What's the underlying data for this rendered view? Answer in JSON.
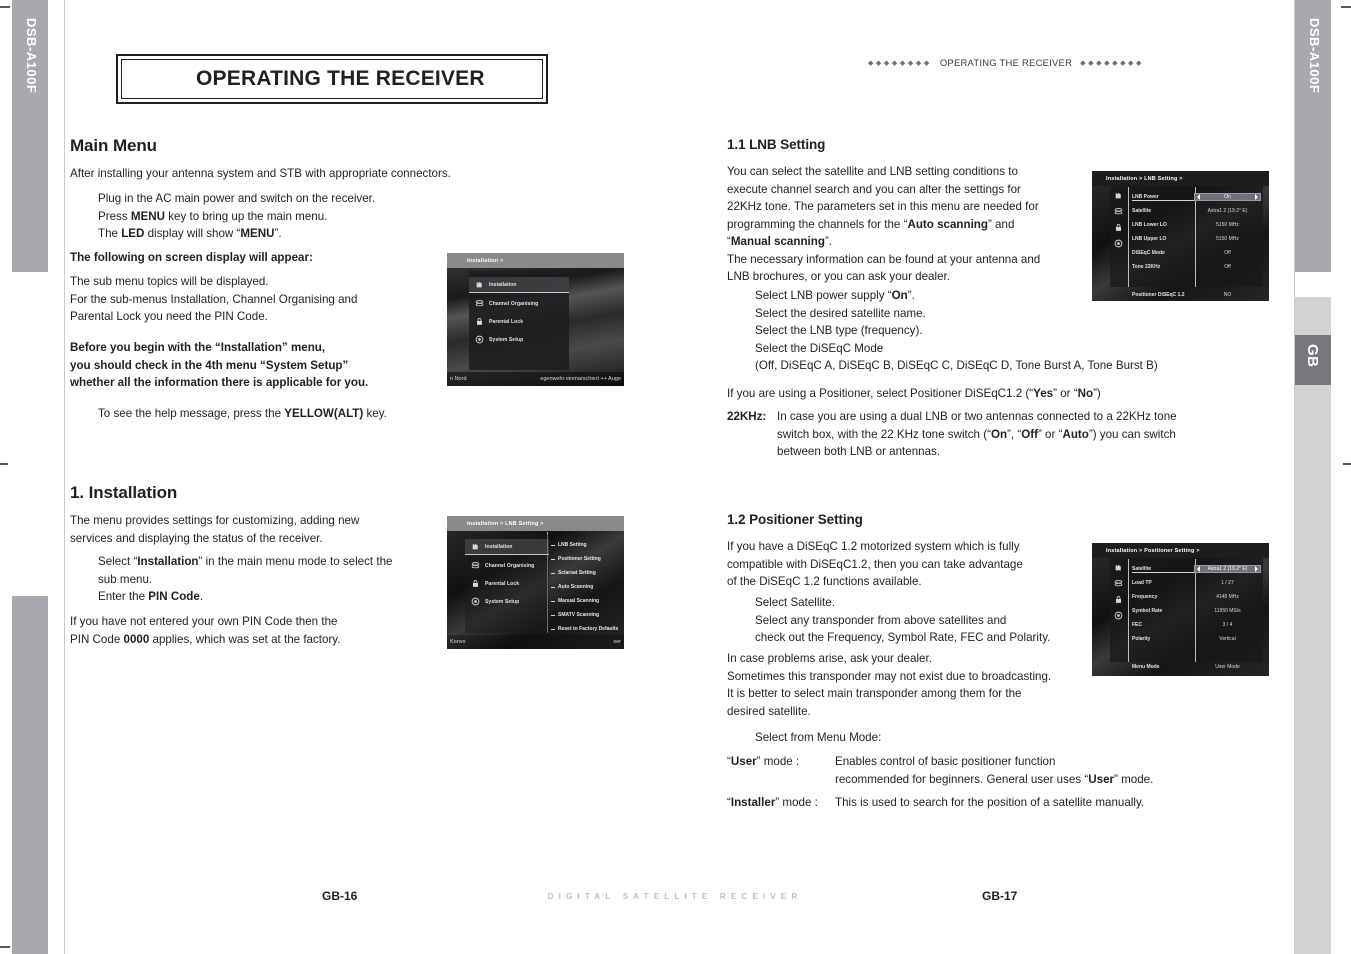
{
  "tabs": {
    "left_top_label": "DSB-A100F",
    "right_top_label": "DSB-A100F",
    "right_lang_label": "GB"
  },
  "left_page": {
    "title": "OPERATING THE RECEIVER",
    "main_menu": {
      "heading": "Main Menu",
      "intro": "After installing your antenna system and STB with appropriate connectors.",
      "steps": [
        "Plug in the AC main power and switch on the receiver.",
        "Press MENU key to bring up the main menu.",
        "The LED display will show “MENU”."
      ],
      "bold_note": "The following on screen display will appear:",
      "para2_line1": "The sub menu topics will be displayed.",
      "para2_line2": "For the sub-menus Installation, Channel Organising and",
      "para2_line3": "Parental Lock you need the PIN Code.",
      "warning_line1": "Before you begin with the “Installation” menu,",
      "warning_line2": "you should check in the 4th menu “System Setup”",
      "warning_line3": "whether all the information there is applicable for you.",
      "help_line": "To see the help message, press the YELLOW(ALT) key."
    },
    "installation": {
      "heading": "1. Installation",
      "intro_line1": "The menu provides settings for customizing, adding new",
      "intro_line2": "services and displaying the status of the receiver.",
      "step1_line1": "Select “Installation” in the main menu mode to select the",
      "step1_line2": "sub menu.",
      "step2": "Enter the PIN Code.",
      "pin_line1": "If you have not entered your own PIN Code then the",
      "pin_line2": "PIN Code 0000 applies, which was set at the factory."
    }
  },
  "right_page": {
    "running_head": "OPERATING THE RECEIVER",
    "lnb": {
      "heading": "1.1 LNB Setting",
      "para_line1": "You can select the satellite and  LNB setting conditions to",
      "para_line2": "execute channel search and you can alter the settings for",
      "para_line3": "22KHz tone. The parameters set in this menu are needed for",
      "para_line4_a": "programming the channels for the “",
      "para_line4_b": "Auto scanning",
      "para_line4_c": "” and",
      "para_line5_a": "“",
      "para_line5_b": "Manual scanning",
      "para_line5_c": "”.",
      "para_line6": "The necessary information can be found at your antenna and",
      "para_line7": "LNB brochures, or you can ask your dealer.",
      "steps": [
        "Select LNB power supply “On”.",
        "Select the desired satellite name.",
        "Select the LNB type (frequency).",
        "Select the DiSEqC Mode",
        "(Off, DiSEqC A, DiSEqC B, DiSEqC C, DiSEqC D, Tone Burst A, Tone Burst B)"
      ],
      "positioner_line": "If you are using a Positioner, select Positioner DiSEqC1.2 (“Yes” or “No”)",
      "khz_label": "22KHz:",
      "khz_line1": "In case you are using a dual LNB or two antennas connected to a 22KHz tone",
      "khz_line2": "switch box, with the 22 KHz tone switch (“On”, “Off” or “Auto”) you can switch",
      "khz_line3": "between both LNB or antennas."
    },
    "positioner": {
      "heading": "1.2 Positioner Setting",
      "para_line1": "If you have a DiSEqC 1.2 motorized system which is fully",
      "para_line2": "compatible with DiSEqC1.2, then you can take advantage",
      "para_line3": "of the DiSEqC 1.2 functions available.",
      "steps": [
        "Select Satellite.",
        "Select any transponder from above satellites and",
        "check out the Frequency, Symbol Rate, FEC and Polarity."
      ],
      "note_line1": "In case problems arise, ask your dealer.",
      "note_line2": "Sometimes this transponder may not exist due to broadcasting.",
      "note_line3": "It is better to select main transponder among them for the",
      "note_line4": "desired satellite.",
      "menu_mode_step": "Select from Menu Mode:",
      "user_mode_label": "“User” mode :",
      "user_mode_line1": "Enables control of basic positioner function",
      "user_mode_line2": "recommended for beginners. General user uses “User” mode.",
      "installer_mode_label": "“Installer” mode :",
      "installer_mode_text": "This is used to search for the position of a satellite manually."
    }
  },
  "osd": {
    "main_menu": {
      "breadcrumb": "Installation >",
      "items": [
        {
          "label": "Installation",
          "icon": "installation-icon",
          "selected": true
        },
        {
          "label": "Channel Organising",
          "icon": "channel-icon",
          "selected": false
        },
        {
          "label": "Parental Lock",
          "icon": "lock-icon",
          "selected": false
        },
        {
          "label": "System Setup",
          "icon": "gear-icon",
          "selected": false
        }
      ],
      "ticker_left": "n Nord",
      "ticker_right": "egenwehr einmarschiert ++ Auge"
    },
    "installation_menu": {
      "breadcrumb": "Installation > LNB Setting >",
      "items": [
        {
          "label": "Installation",
          "icon": "installation-icon",
          "selected": true
        },
        {
          "label": "Channel Organising",
          "icon": "channel-icon",
          "selected": false
        },
        {
          "label": "Parental Lock",
          "icon": "lock-icon",
          "selected": false
        },
        {
          "label": "System Setup",
          "icon": "gear-icon",
          "selected": false
        }
      ],
      "submenu": [
        "LNB Setting",
        "Positioner Setting",
        "Sclarsat Setting",
        "Auto Scanning",
        "Manual Scanning",
        "SMATV Scanning",
        "Reset to Factory Defaults"
      ],
      "ticker_left": "Konvo",
      "ticker_right": "ser"
    },
    "lnb_setting": {
      "breadcrumb": "Installation > LNB Setting >",
      "rows": [
        {
          "label": "LNB Power",
          "value": "On",
          "highlight": true
        },
        {
          "label": "Satellite",
          "value": "Astra1 2 (19.2° E)",
          "highlight": false
        },
        {
          "label": "LNB Lower LO",
          "value": "5150 MHz",
          "highlight": false
        },
        {
          "label": "LNB Upper LO",
          "value": "5150 MHz",
          "highlight": false
        },
        {
          "label": "DiSEqC Mode",
          "value": "Off",
          "highlight": false
        },
        {
          "label": "Tone 22KHz",
          "value": "Off",
          "highlight": false
        },
        {
          "label": "",
          "value": "",
          "highlight": false
        },
        {
          "label": "Positioner DiSEqC 1.2",
          "value": "NO",
          "highlight": false
        }
      ]
    },
    "positioner_setting": {
      "breadcrumb": "Installation > Positioner Setting >",
      "rows": [
        {
          "label": "Satellite",
          "value": "Astra1 2 (19.2° E)",
          "highlight": true
        },
        {
          "label": "Load TP",
          "value": "1 / 27",
          "highlight": false
        },
        {
          "label": "Frequency",
          "value": "4148 MHz",
          "highlight": false
        },
        {
          "label": "Symbol Rate",
          "value": "11950 MS/s",
          "highlight": false
        },
        {
          "label": "FEC",
          "value": "3 / 4",
          "highlight": false
        },
        {
          "label": "Polarity",
          "value": "Vertical",
          "highlight": false
        },
        {
          "label": "",
          "value": "",
          "highlight": false
        },
        {
          "label": "Menu Mode",
          "value": "User Mode",
          "highlight": false
        }
      ]
    }
  },
  "footer": {
    "left_page_number": "GB-16",
    "center_text": "DIGITAL SATELLITE RECEIVER",
    "right_page_number": "GB-17"
  }
}
